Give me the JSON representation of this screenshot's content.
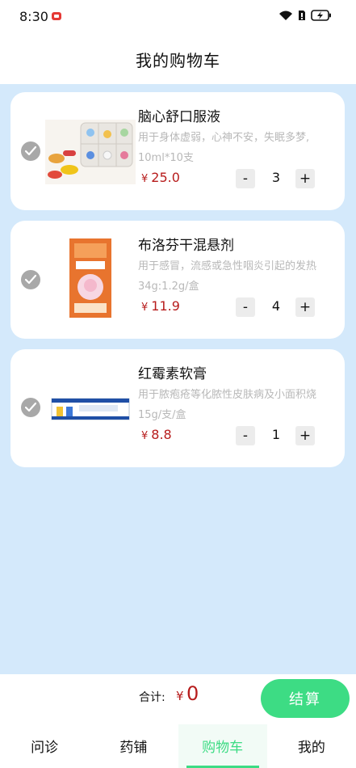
{
  "status_bar": {
    "time": "8:30"
  },
  "header": {
    "title": "我的购物车"
  },
  "cart": {
    "items": [
      {
        "name": "脑心舒口服液",
        "description": "用于身体虚弱，心神不安，失眠多梦,",
        "spec": "10ml*10支",
        "currency": "¥",
        "price": "25.0",
        "quantity": "3",
        "minus_label": "-",
        "plus_label": "+"
      },
      {
        "name": "布洛芬干混悬剂",
        "description": "用于感冒，流感或急性咽炎引起的发热",
        "spec": "34g:1.2g/盒",
        "currency": "¥",
        "price": "11.9",
        "quantity": "4",
        "minus_label": "-",
        "plus_label": "+"
      },
      {
        "name": "红霉素软膏",
        "description": "用于脓疱疮等化脓性皮肤病及小面积烧",
        "spec": "15g/支/盒",
        "currency": "¥",
        "price": "8.8",
        "quantity": "1",
        "minus_label": "-",
        "plus_label": "+"
      }
    ]
  },
  "checkout": {
    "total_label": "合计:",
    "currency": "¥",
    "total": "0",
    "button_label": "结算"
  },
  "tabs": [
    {
      "label": "问诊",
      "active": false
    },
    {
      "label": "药铺",
      "active": false
    },
    {
      "label": "购物车",
      "active": true
    },
    {
      "label": "我的",
      "active": false
    }
  ],
  "colors": {
    "accent": "#3DDC84",
    "price": "#B71C1C",
    "background": "#D4E9FB",
    "check": "#A8A8A8"
  },
  "icons": [
    "recording-icon",
    "wifi-icon",
    "sim-icon",
    "battery-charging-icon",
    "check-circle-icon"
  ]
}
